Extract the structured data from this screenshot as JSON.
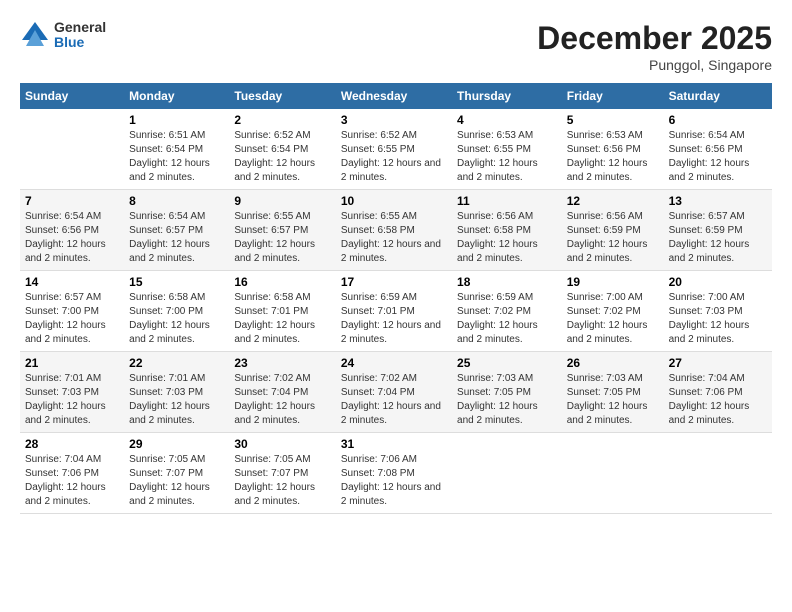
{
  "logo": {
    "general": "General",
    "blue": "Blue"
  },
  "title": "December 2025",
  "subtitle": "Punggol, Singapore",
  "days_header": [
    "Sunday",
    "Monday",
    "Tuesday",
    "Wednesday",
    "Thursday",
    "Friday",
    "Saturday"
  ],
  "weeks": [
    [
      {
        "num": "",
        "sunrise": "",
        "sunset": "",
        "daylight": ""
      },
      {
        "num": "1",
        "sunrise": "Sunrise: 6:51 AM",
        "sunset": "Sunset: 6:54 PM",
        "daylight": "Daylight: 12 hours and 2 minutes."
      },
      {
        "num": "2",
        "sunrise": "Sunrise: 6:52 AM",
        "sunset": "Sunset: 6:54 PM",
        "daylight": "Daylight: 12 hours and 2 minutes."
      },
      {
        "num": "3",
        "sunrise": "Sunrise: 6:52 AM",
        "sunset": "Sunset: 6:55 PM",
        "daylight": "Daylight: 12 hours and 2 minutes."
      },
      {
        "num": "4",
        "sunrise": "Sunrise: 6:53 AM",
        "sunset": "Sunset: 6:55 PM",
        "daylight": "Daylight: 12 hours and 2 minutes."
      },
      {
        "num": "5",
        "sunrise": "Sunrise: 6:53 AM",
        "sunset": "Sunset: 6:56 PM",
        "daylight": "Daylight: 12 hours and 2 minutes."
      },
      {
        "num": "6",
        "sunrise": "Sunrise: 6:54 AM",
        "sunset": "Sunset: 6:56 PM",
        "daylight": "Daylight: 12 hours and 2 minutes."
      }
    ],
    [
      {
        "num": "7",
        "sunrise": "Sunrise: 6:54 AM",
        "sunset": "Sunset: 6:56 PM",
        "daylight": "Daylight: 12 hours and 2 minutes."
      },
      {
        "num": "8",
        "sunrise": "Sunrise: 6:54 AM",
        "sunset": "Sunset: 6:57 PM",
        "daylight": "Daylight: 12 hours and 2 minutes."
      },
      {
        "num": "9",
        "sunrise": "Sunrise: 6:55 AM",
        "sunset": "Sunset: 6:57 PM",
        "daylight": "Daylight: 12 hours and 2 minutes."
      },
      {
        "num": "10",
        "sunrise": "Sunrise: 6:55 AM",
        "sunset": "Sunset: 6:58 PM",
        "daylight": "Daylight: 12 hours and 2 minutes."
      },
      {
        "num": "11",
        "sunrise": "Sunrise: 6:56 AM",
        "sunset": "Sunset: 6:58 PM",
        "daylight": "Daylight: 12 hours and 2 minutes."
      },
      {
        "num": "12",
        "sunrise": "Sunrise: 6:56 AM",
        "sunset": "Sunset: 6:59 PM",
        "daylight": "Daylight: 12 hours and 2 minutes."
      },
      {
        "num": "13",
        "sunrise": "Sunrise: 6:57 AM",
        "sunset": "Sunset: 6:59 PM",
        "daylight": "Daylight: 12 hours and 2 minutes."
      }
    ],
    [
      {
        "num": "14",
        "sunrise": "Sunrise: 6:57 AM",
        "sunset": "Sunset: 7:00 PM",
        "daylight": "Daylight: 12 hours and 2 minutes."
      },
      {
        "num": "15",
        "sunrise": "Sunrise: 6:58 AM",
        "sunset": "Sunset: 7:00 PM",
        "daylight": "Daylight: 12 hours and 2 minutes."
      },
      {
        "num": "16",
        "sunrise": "Sunrise: 6:58 AM",
        "sunset": "Sunset: 7:01 PM",
        "daylight": "Daylight: 12 hours and 2 minutes."
      },
      {
        "num": "17",
        "sunrise": "Sunrise: 6:59 AM",
        "sunset": "Sunset: 7:01 PM",
        "daylight": "Daylight: 12 hours and 2 minutes."
      },
      {
        "num": "18",
        "sunrise": "Sunrise: 6:59 AM",
        "sunset": "Sunset: 7:02 PM",
        "daylight": "Daylight: 12 hours and 2 minutes."
      },
      {
        "num": "19",
        "sunrise": "Sunrise: 7:00 AM",
        "sunset": "Sunset: 7:02 PM",
        "daylight": "Daylight: 12 hours and 2 minutes."
      },
      {
        "num": "20",
        "sunrise": "Sunrise: 7:00 AM",
        "sunset": "Sunset: 7:03 PM",
        "daylight": "Daylight: 12 hours and 2 minutes."
      }
    ],
    [
      {
        "num": "21",
        "sunrise": "Sunrise: 7:01 AM",
        "sunset": "Sunset: 7:03 PM",
        "daylight": "Daylight: 12 hours and 2 minutes."
      },
      {
        "num": "22",
        "sunrise": "Sunrise: 7:01 AM",
        "sunset": "Sunset: 7:03 PM",
        "daylight": "Daylight: 12 hours and 2 minutes."
      },
      {
        "num": "23",
        "sunrise": "Sunrise: 7:02 AM",
        "sunset": "Sunset: 7:04 PM",
        "daylight": "Daylight: 12 hours and 2 minutes."
      },
      {
        "num": "24",
        "sunrise": "Sunrise: 7:02 AM",
        "sunset": "Sunset: 7:04 PM",
        "daylight": "Daylight: 12 hours and 2 minutes."
      },
      {
        "num": "25",
        "sunrise": "Sunrise: 7:03 AM",
        "sunset": "Sunset: 7:05 PM",
        "daylight": "Daylight: 12 hours and 2 minutes."
      },
      {
        "num": "26",
        "sunrise": "Sunrise: 7:03 AM",
        "sunset": "Sunset: 7:05 PM",
        "daylight": "Daylight: 12 hours and 2 minutes."
      },
      {
        "num": "27",
        "sunrise": "Sunrise: 7:04 AM",
        "sunset": "Sunset: 7:06 PM",
        "daylight": "Daylight: 12 hours and 2 minutes."
      }
    ],
    [
      {
        "num": "28",
        "sunrise": "Sunrise: 7:04 AM",
        "sunset": "Sunset: 7:06 PM",
        "daylight": "Daylight: 12 hours and 2 minutes."
      },
      {
        "num": "29",
        "sunrise": "Sunrise: 7:05 AM",
        "sunset": "Sunset: 7:07 PM",
        "daylight": "Daylight: 12 hours and 2 minutes."
      },
      {
        "num": "30",
        "sunrise": "Sunrise: 7:05 AM",
        "sunset": "Sunset: 7:07 PM",
        "daylight": "Daylight: 12 hours and 2 minutes."
      },
      {
        "num": "31",
        "sunrise": "Sunrise: 7:06 AM",
        "sunset": "Sunset: 7:08 PM",
        "daylight": "Daylight: 12 hours and 2 minutes."
      },
      {
        "num": "",
        "sunrise": "",
        "sunset": "",
        "daylight": ""
      },
      {
        "num": "",
        "sunrise": "",
        "sunset": "",
        "daylight": ""
      },
      {
        "num": "",
        "sunrise": "",
        "sunset": "",
        "daylight": ""
      }
    ]
  ]
}
